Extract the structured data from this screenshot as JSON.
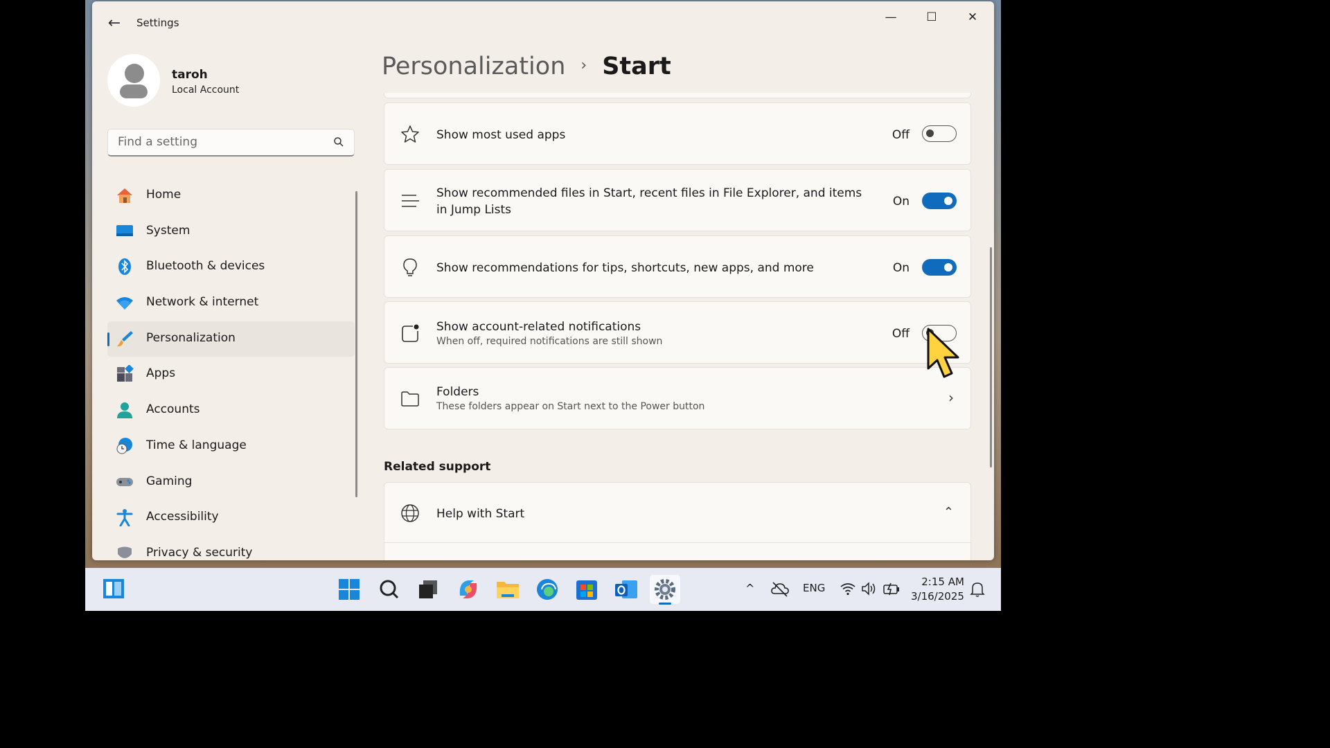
{
  "window": {
    "title": "Settings",
    "back_label": "←",
    "controls": {
      "minimize": "—",
      "maximize": "☐",
      "close": "✕"
    }
  },
  "profile": {
    "name": "taroh",
    "account_type": "Local Account"
  },
  "search": {
    "placeholder": "Find a setting"
  },
  "sidebar": {
    "items": [
      {
        "label": "Home",
        "icon": "home-icon"
      },
      {
        "label": "System",
        "icon": "monitor-icon"
      },
      {
        "label": "Bluetooth & devices",
        "icon": "bluetooth-icon"
      },
      {
        "label": "Network & internet",
        "icon": "wifi-icon"
      },
      {
        "label": "Personalization",
        "icon": "brush-icon",
        "selected": true
      },
      {
        "label": "Apps",
        "icon": "apps-icon"
      },
      {
        "label": "Accounts",
        "icon": "person-icon"
      },
      {
        "label": "Time & language",
        "icon": "globe-clock-icon"
      },
      {
        "label": "Gaming",
        "icon": "controller-icon"
      },
      {
        "label": "Accessibility",
        "icon": "accessibility-icon"
      },
      {
        "label": "Privacy & security",
        "icon": "shield-icon"
      }
    ]
  },
  "breadcrumb": {
    "parent": "Personalization",
    "separator": "›",
    "current": "Start"
  },
  "settings": [
    {
      "title": "Show most used apps",
      "state": "Off",
      "icon": "star-icon"
    },
    {
      "title": "Show recommended files in Start, recent files in File Explorer, and items in Jump Lists",
      "state": "On",
      "icon": "list-icon"
    },
    {
      "title": "Show recommendations for tips, shortcuts, new apps, and more",
      "state": "On",
      "icon": "lightbulb-icon"
    },
    {
      "title": "Show account-related notifications",
      "subtitle": "When off, required notifications are still shown",
      "state": "Off",
      "icon": "notification-icon"
    },
    {
      "title": "Folders",
      "subtitle": "These folders appear on Start next to the Power button",
      "icon": "folder-icon",
      "chevron": "›"
    }
  ],
  "related_support": {
    "heading": "Related support",
    "items": [
      {
        "title": "Help with Start",
        "icon": "globe-icon",
        "chevron": "⌃"
      }
    ]
  },
  "taskbar": {
    "apps": [
      "widgets-icon",
      "start-icon",
      "search-icon",
      "task-view-icon",
      "copilot-icon",
      "file-explorer-icon",
      "edge-icon",
      "store-icon",
      "outlook-icon",
      "settings-icon"
    ],
    "tray": {
      "chevron": "^",
      "language": "ENG",
      "time": "2:15 AM",
      "date": "3/16/2025"
    }
  },
  "colors": {
    "accent": "#0f6cbd",
    "window_bg": "#f3eee8",
    "card_bg": "#fbf9f6"
  }
}
